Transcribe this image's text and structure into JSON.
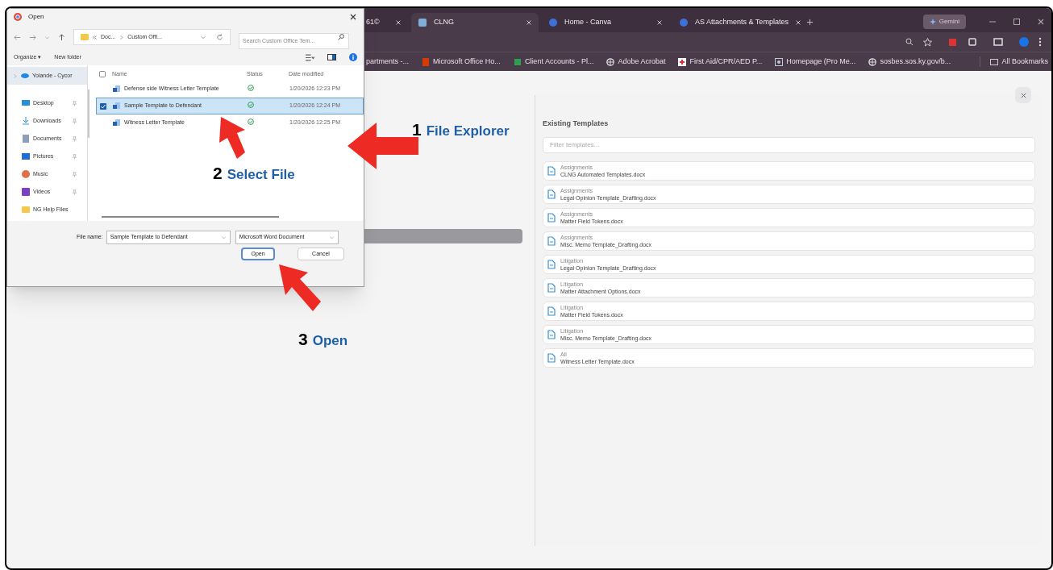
{
  "browser": {
    "tabs": [
      {
        "title": "61©",
        "selected": false,
        "kind": "partial"
      },
      {
        "title": "CLNG",
        "selected": true,
        "kind": "page"
      },
      {
        "title": "Home - Canva",
        "selected": false,
        "kind": "circle"
      },
      {
        "title": "AS Attachments & Templates",
        "selected": false,
        "kind": "circle"
      }
    ],
    "gemini_button": "Gemini",
    "bookmarks": [
      {
        "label": "partments -...",
        "kind": "partial"
      },
      {
        "label": "Microsoft Office Ho...",
        "kind": "office"
      },
      {
        "label": "Client Accounts - Pl...",
        "kind": "sheet"
      },
      {
        "label": "Adobe Acrobat",
        "kind": "globe"
      },
      {
        "label": "First Aid/CPR/AED P...",
        "kind": "aid"
      },
      {
        "label": "Homepage (Pro Me...",
        "kind": "image"
      },
      {
        "label": "sosbes.sos.ky.gov/b...",
        "kind": "globe"
      }
    ],
    "all_bookmarks": "All Bookmarks"
  },
  "panel": {
    "heading": "Existing Templates",
    "filter": {
      "placeholder": "Filter templates..."
    },
    "templates": [
      {
        "category": "Assignments",
        "name": "CLNG Automated Templates.docx"
      },
      {
        "category": "Assignments",
        "name": "Legal Opinion Template_Drafting.docx"
      },
      {
        "category": "Assignments",
        "name": "Matter Field Tokens.docx"
      },
      {
        "category": "Assignments",
        "name": "Misc. Memo Template_Drafting.docx"
      },
      {
        "category": "Litigation",
        "name": "Legal Opinion Template_Drafting.docx"
      },
      {
        "category": "Litigation",
        "name": "Matter Attachment Options.docx"
      },
      {
        "category": "Litigation",
        "name": "Matter Field Tokens.docx"
      },
      {
        "category": "Litigation",
        "name": "Misc. Memo Template_Drafting.docx"
      },
      {
        "category": "All",
        "name": "Witness Letter Template.docx"
      }
    ]
  },
  "dialog": {
    "title": "Open",
    "path": [
      "Doc...",
      "Custom Offi..."
    ],
    "search": {
      "placeholder": "Search Custom Office Tem..."
    },
    "organize": "Organize ▾",
    "new_folder": "New folder",
    "sidebar": [
      {
        "label": "Yolande - Cycor",
        "kind": "cloud",
        "selected": true
      },
      {
        "label": "Desktop",
        "kind": "desktop",
        "selected": false
      },
      {
        "label": "Downloads",
        "kind": "download",
        "selected": false
      },
      {
        "label": "Documents",
        "kind": "documents",
        "selected": false
      },
      {
        "label": "Pictures",
        "kind": "pictures",
        "selected": false
      },
      {
        "label": "Music",
        "kind": "music",
        "selected": false
      },
      {
        "label": "Videos",
        "kind": "videos",
        "selected": false
      },
      {
        "label": "NG Help Files",
        "kind": "folder",
        "selected": false
      }
    ],
    "columns": [
      "Name",
      "Status",
      "Date modified"
    ],
    "files": [
      {
        "name": "Defense side Witness Letter Template",
        "date": "1/20/2026 12:23 PM",
        "selected": false
      },
      {
        "name": "Sample Template to Defendant",
        "date": "1/20/2026 12:24 PM",
        "selected": true
      },
      {
        "name": "Witness Letter Template",
        "date": "1/20/2026 12:25 PM",
        "selected": false
      }
    ],
    "file_name_label": "File name:",
    "file_name": "Sample Template to Defendant",
    "file_type": "Microsoft Word Document",
    "buttons": [
      "Open",
      "Cancel"
    ]
  },
  "annotations": [
    {
      "number": "1",
      "label": "File Explorer"
    },
    {
      "number": "2",
      "label": "Select File"
    },
    {
      "number": "3",
      "label": "Open"
    }
  ]
}
